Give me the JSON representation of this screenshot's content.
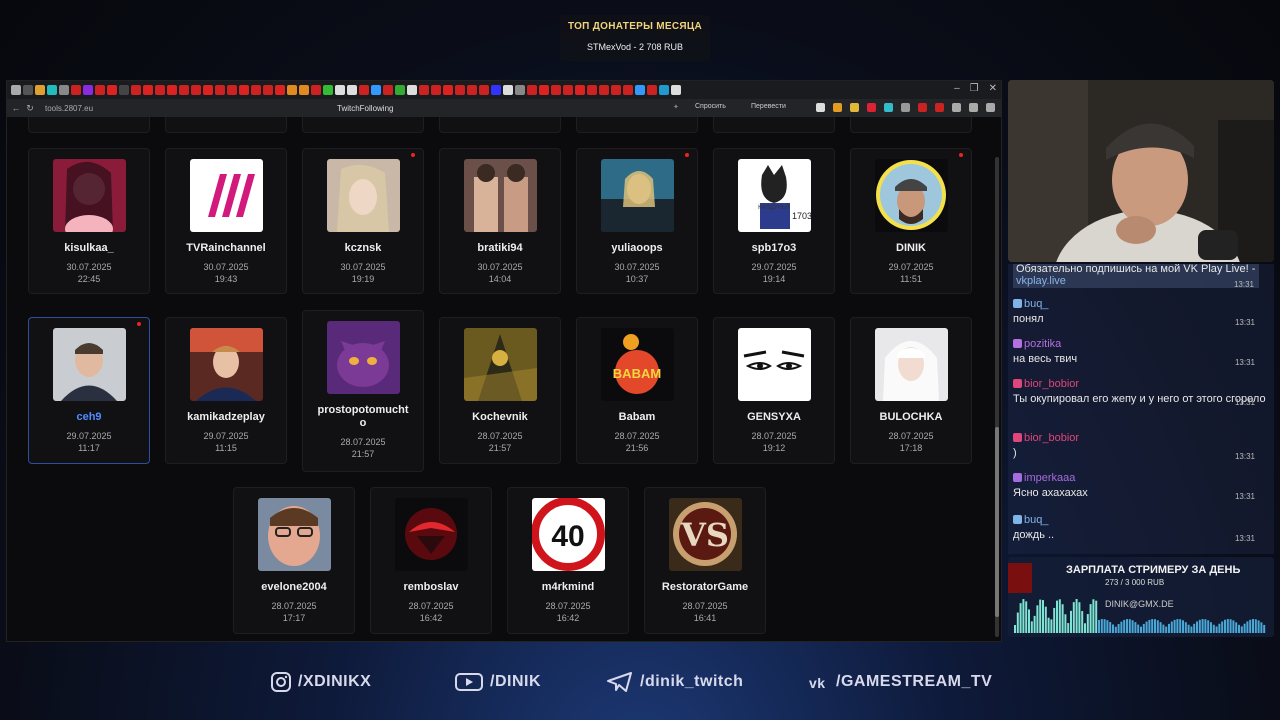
{
  "banner": {
    "title": "ТОП ДОНАТЕРЫ МЕСЯЦА",
    "donor": "STMexVod - 2 708 RUB"
  },
  "browser": {
    "url": "tools.2807.eu",
    "page_title": "TwitchFollowing",
    "ask": "Спросить",
    "translate": "Перевести"
  },
  "cards": [
    {
      "name": "kisulkaa_",
      "date": "30.07.2025",
      "time": "22:45"
    },
    {
      "name": "TVRainchannel",
      "date": "30.07.2025",
      "time": "19:43"
    },
    {
      "name": "kcznsk",
      "date": "30.07.2025",
      "time": "19:19"
    },
    {
      "name": "bratiki94",
      "date": "30.07.2025",
      "time": "14:04"
    },
    {
      "name": "yuliaoops",
      "date": "30.07.2025",
      "time": "10:37"
    },
    {
      "name": "spb17o3",
      "date": "29.07.2025",
      "time": "19:14"
    },
    {
      "name": "DINIK",
      "date": "29.07.2025",
      "time": "11:51"
    },
    {
      "name": "ceh9",
      "date": "29.07.2025",
      "time": "11:17"
    },
    {
      "name": "kamikadzeplay",
      "date": "29.07.2025",
      "time": "11:15"
    },
    {
      "name": "prostopotomuchto",
      "date": "28.07.2025",
      "time": "21:57"
    },
    {
      "name": "Kochevnik",
      "date": "28.07.2025",
      "time": "21:57"
    },
    {
      "name": "Babam",
      "date": "28.07.2025",
      "time": "21:56"
    },
    {
      "name": "GENSYXA",
      "date": "28.07.2025",
      "time": "19:12"
    },
    {
      "name": "BULOCHKA",
      "date": "28.07.2025",
      "time": "17:18"
    },
    {
      "name": "evelone2004",
      "date": "28.07.2025",
      "time": "17:17"
    },
    {
      "name": "remboslav",
      "date": "28.07.2025",
      "time": "16:42"
    },
    {
      "name": "m4rkmind",
      "date": "28.07.2025",
      "time": "16:42"
    },
    {
      "name": "RestoratorGame",
      "date": "28.07.2025",
      "time": "16:41"
    }
  ],
  "avatar_text": {
    "spb_line1": "КАЛДУНЬЯ",
    "spb_line2": "1703",
    "speed": "40",
    "babam": "BABAM",
    "vs": "VS"
  },
  "chat": {
    "top_text": "Обязательно подпишись на мой VK Play Live! - ",
    "top_link": "vkplay.live",
    "messages": [
      {
        "user": "buq_",
        "text": "понял",
        "time": "13:31",
        "color": "#7fb4e8"
      },
      {
        "user": "pozitika",
        "text": "на весь твич",
        "time": "13:31",
        "color": "#b46fe0"
      },
      {
        "user": "bior_bobior",
        "text": "Ты окупировал его жепу и у него от этого сгорело",
        "time": "13:31",
        "color": "#e0457b"
      },
      {
        "user": "bior_bobior",
        "text": ")",
        "time": "13:31",
        "color": "#e0457b"
      },
      {
        "user": "imperkaaa",
        "text": "Ясно ахахахах",
        "time": "13:31",
        "color": "#a76be0"
      },
      {
        "user": "buq_",
        "text": "дождь ..",
        "time": "13:31",
        "color": "#7fb4e8"
      }
    ],
    "top_time": "13:31"
  },
  "goal": {
    "title": "ЗАРПЛАТА СТРИМЕРУ ЗА ДЕНЬ",
    "progress": "273 / 3 000 RUB",
    "progress_fraction": 0.091,
    "email": "DINIK@GMX.DE"
  },
  "socials": [
    "/XDINIKX",
    "/DINIK",
    "/dinik_twitch",
    "/GAMESTREAM_TV"
  ]
}
